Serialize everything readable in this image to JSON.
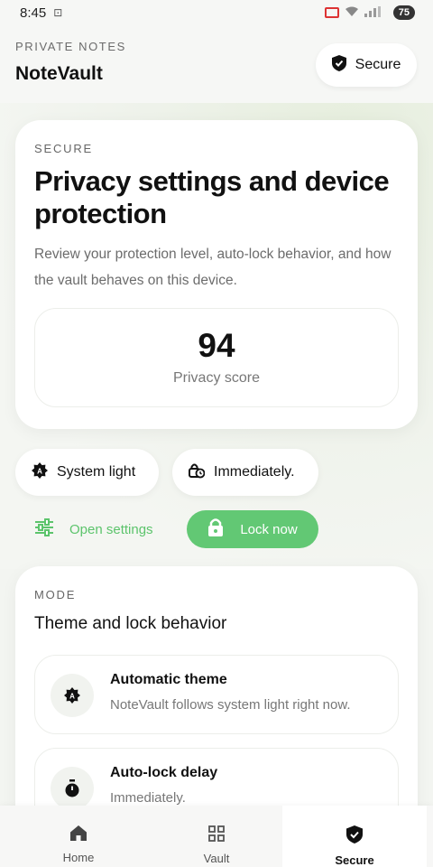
{
  "status_bar": {
    "time": "8:45",
    "battery": "75"
  },
  "header": {
    "kicker": "PRIVATE NOTES",
    "app_title": "NoteVault",
    "badge_label": "Secure"
  },
  "hero": {
    "eyebrow": "SECURE",
    "title": "Privacy settings and device protection",
    "description": "Review your protection level, auto-lock behavior, and how the vault behaves on this device.",
    "score_value": "94",
    "score_label": "Privacy score"
  },
  "chips": {
    "theme": "System light",
    "lock": "Immediately."
  },
  "actions": {
    "open_settings": "Open settings",
    "lock_now": "Lock now"
  },
  "mode": {
    "eyebrow": "MODE",
    "title": "Theme and lock behavior",
    "rows": [
      {
        "title": "Automatic theme",
        "subtitle": "NoteVault follows system light right now.",
        "icon": "theme-icon"
      },
      {
        "title": "Auto-lock delay",
        "subtitle": "Immediately.",
        "icon": "timer-icon"
      }
    ]
  },
  "nav": {
    "items": [
      {
        "label": "Home",
        "icon": "home-icon"
      },
      {
        "label": "Vault",
        "icon": "grid-icon"
      },
      {
        "label": "Secure",
        "icon": "shield-icon"
      }
    ],
    "active": "Secure"
  },
  "colors": {
    "accent_green": "#62c874",
    "accent_green_text": "#5cc46c"
  }
}
